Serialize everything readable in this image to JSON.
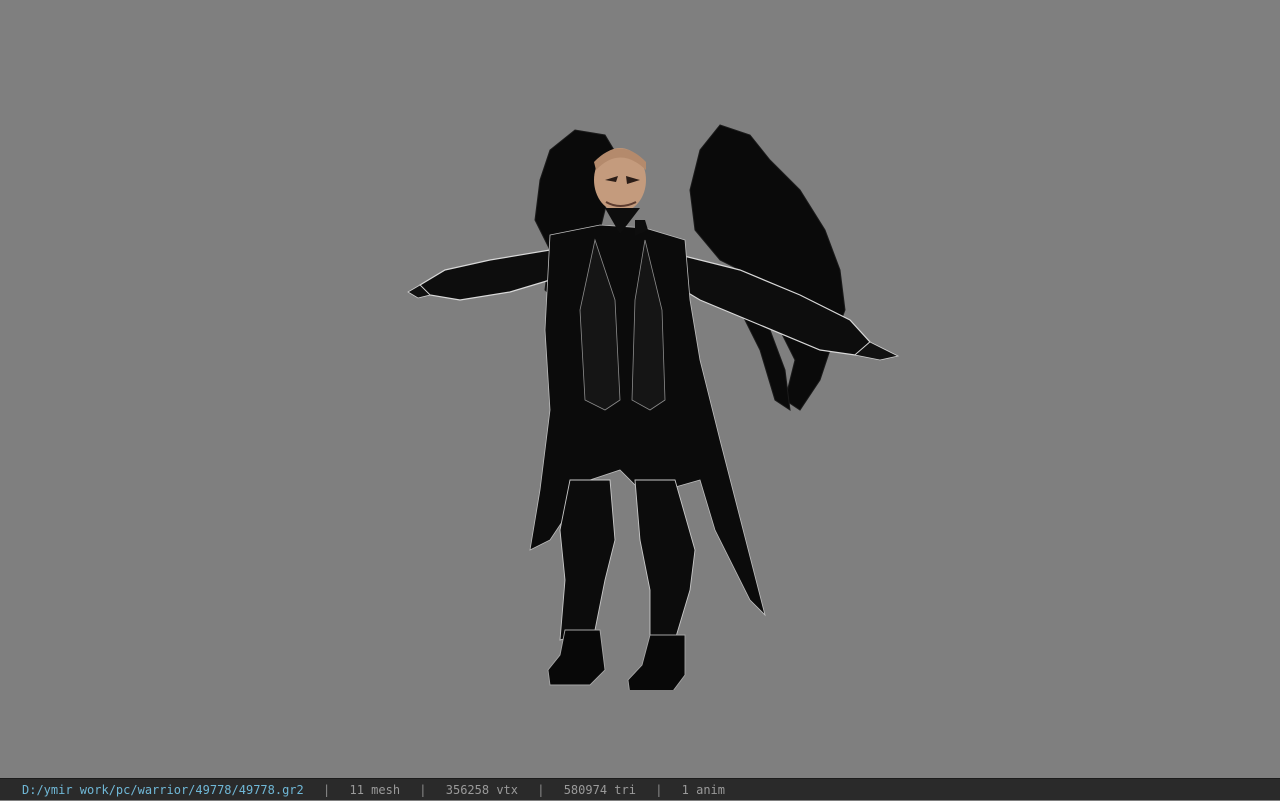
{
  "status": {
    "file_path": "D:/ymir work/pc/warrior/49778/49778.gr2",
    "separator": "|",
    "mesh": "11 mesh",
    "vertices": "356258 vtx",
    "triangles": "580974 tri",
    "anims": "1 anim"
  },
  "colors": {
    "viewport_bg": "#7f7f7f",
    "statusbar_bg": "#2a2a2a",
    "path_text": "#6fb7d6",
    "stat_text": "#9a9a9a"
  }
}
